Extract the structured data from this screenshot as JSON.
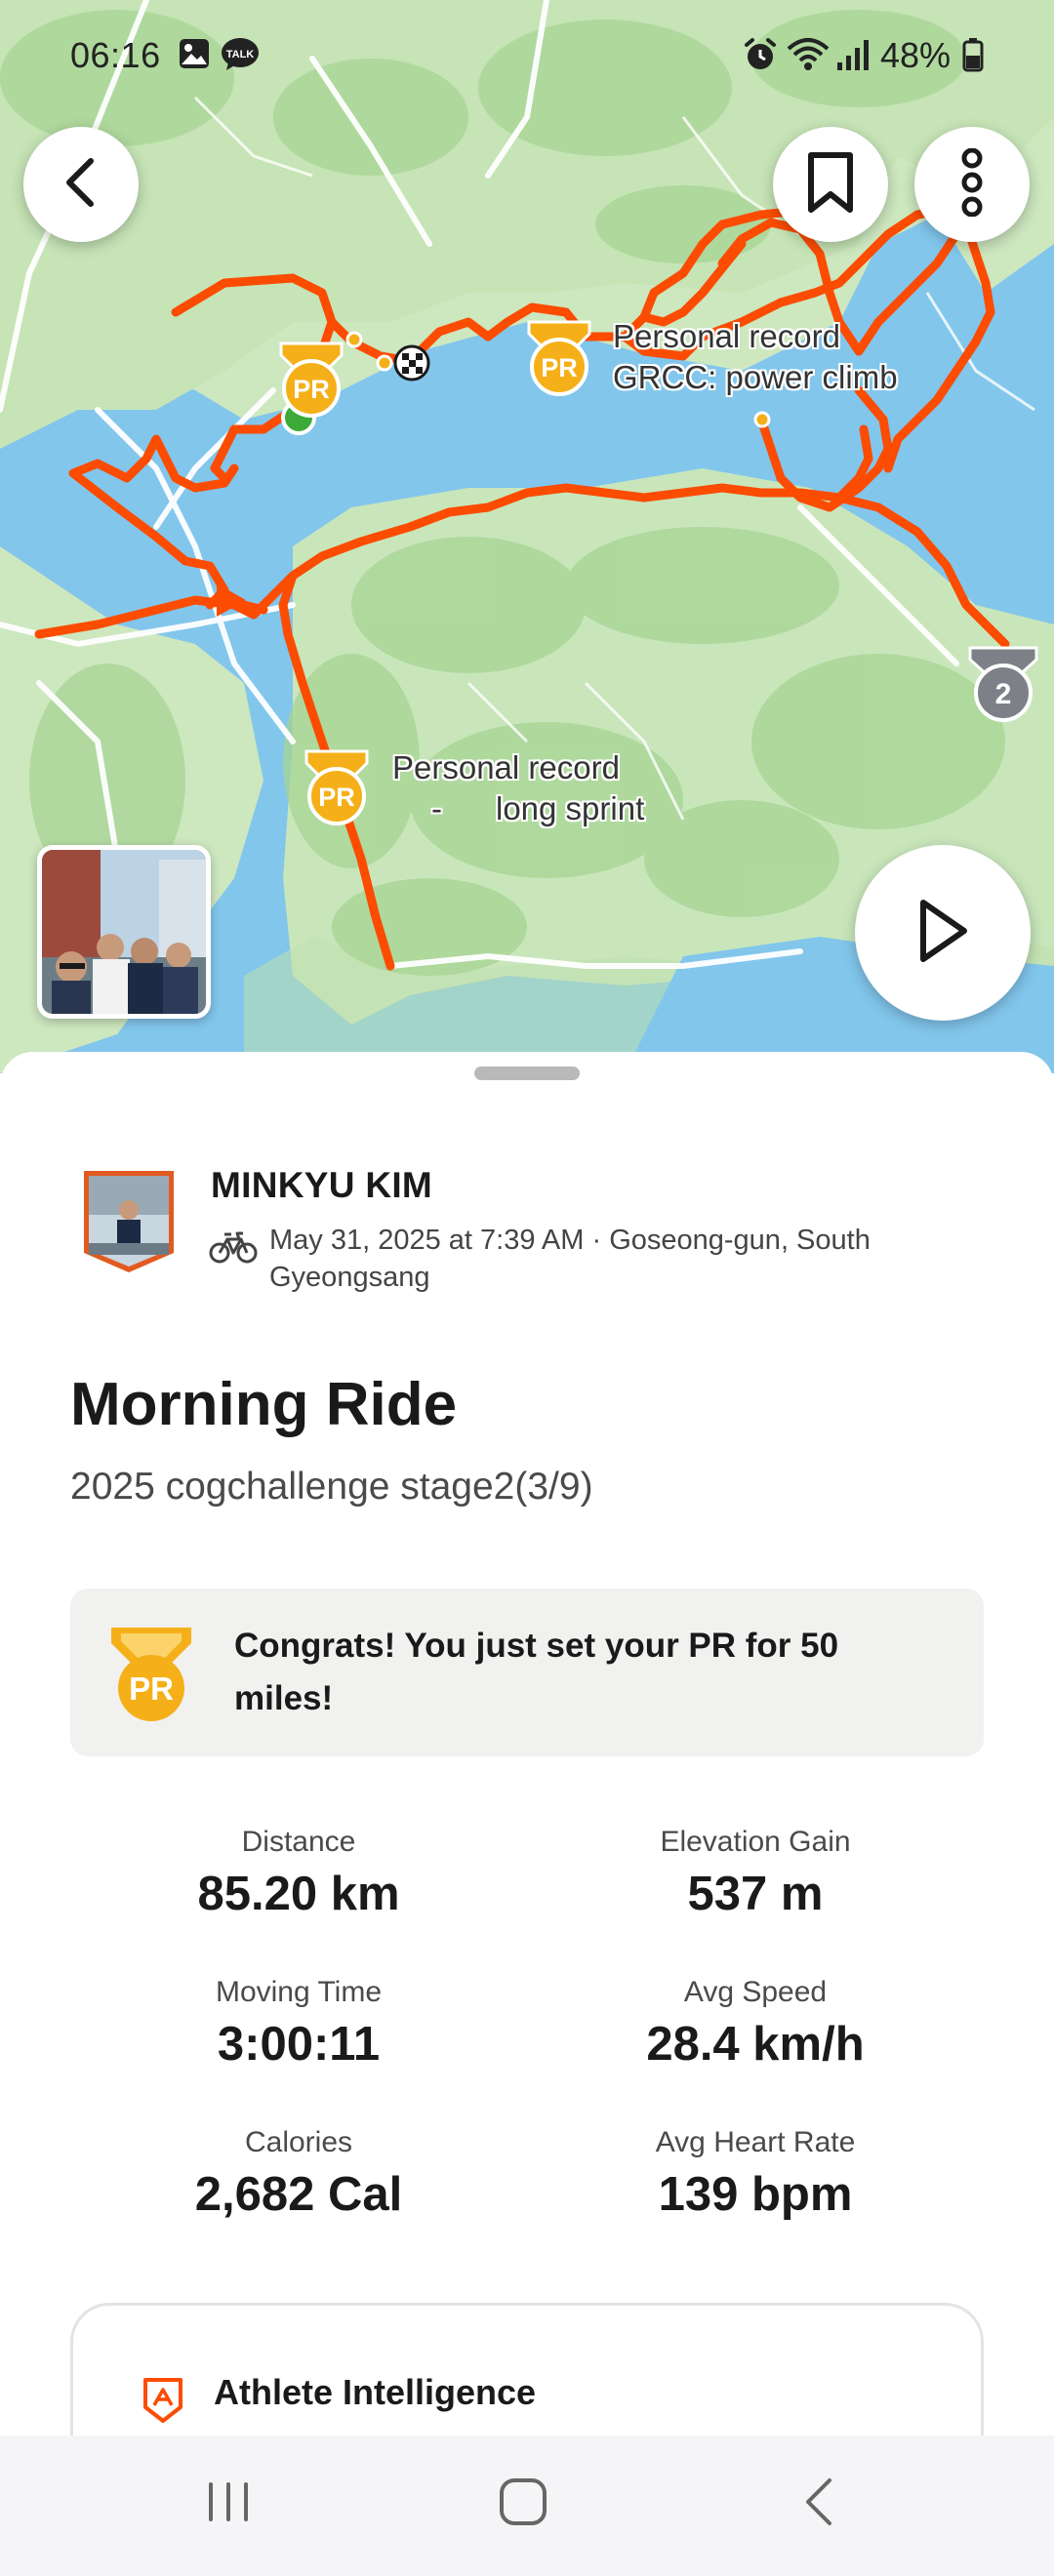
{
  "status_bar": {
    "time": "06:16",
    "battery": "48%",
    "icons": [
      "gallery-icon",
      "talk-icon",
      "alarm-icon",
      "wifi-icon",
      "signal-icon",
      "battery-icon"
    ],
    "talk_label": "TALK"
  },
  "map": {
    "badges": {
      "pr": "PR",
      "medal": "2"
    },
    "labels": {
      "pr_climb_line1": "Personal record",
      "pr_climb_line2": "GRCC: power climb",
      "pr_sprint_line1": "Personal record",
      "pr_sprint_line2": "-      long sprint"
    },
    "buttons": [
      "back-icon",
      "bookmark-icon",
      "more-icon",
      "play-icon"
    ],
    "colors": {
      "water": "#7fc4ec",
      "land": "#cfe8c1",
      "route": "#fc4c02",
      "pr_gold": "#f5b019"
    }
  },
  "activity": {
    "athlete_name": "MINKYU KIM",
    "meta": "May 31, 2025 at 7:39 AM · Goseong-gun, South Gyeongsang",
    "title": "Morning Ride",
    "description": "2025 cogchallenge stage2(3/9)",
    "pr_banner": "Congrats! You just set your PR for 50 miles!",
    "stats": [
      {
        "label": "Distance",
        "value": "85.20 km"
      },
      {
        "label": "Elevation Gain",
        "value": "537 m"
      },
      {
        "label": "Moving Time",
        "value": "3:00:11"
      },
      {
        "label": "Avg Speed",
        "value": "28.4 km/h"
      },
      {
        "label": "Calories",
        "value": "2,682 Cal"
      },
      {
        "label": "Avg Heart Rate",
        "value": "139 bpm"
      }
    ],
    "athlete_intelligence": "Athlete Intelligence"
  },
  "navbar": {
    "items": [
      "recents-icon",
      "home-icon",
      "back-nav-icon"
    ]
  }
}
